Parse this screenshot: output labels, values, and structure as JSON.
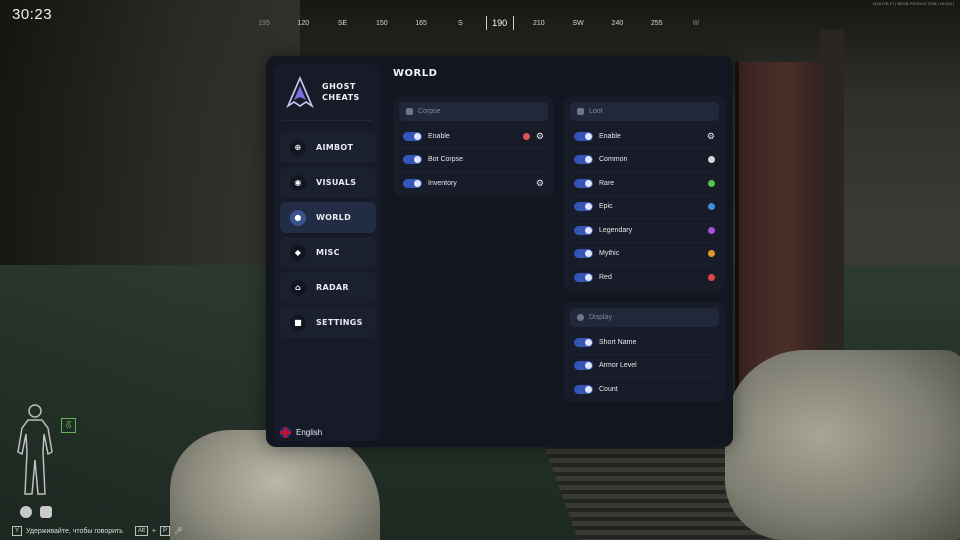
{
  "hud": {
    "timer": "30:23",
    "compass": [
      "195",
      "120",
      "SE",
      "150",
      "165",
      "S",
      "190",
      "210",
      "SW",
      "240",
      "255",
      "W"
    ],
    "compass_center": "190",
    "server_info": "1104 IVB 17 | BEGB PRODUCTION | v0.016 |",
    "voice_hint": "Удерживайте, чтобы говорить",
    "voice_key": "Y",
    "alt_key": "Alt",
    "plus": "+",
    "p_key": "P"
  },
  "brand": {
    "line1": "GHOST",
    "line2": "CHEATS"
  },
  "nav": [
    {
      "label": "AIMBOT",
      "icon": "crosshair-icon",
      "glyph": "⊕"
    },
    {
      "label": "VISUALS",
      "icon": "eye-icon",
      "glyph": "◉"
    },
    {
      "label": "WORLD",
      "icon": "globe-icon",
      "glyph": "●"
    },
    {
      "label": "MISC",
      "icon": "shield-icon",
      "glyph": "◆"
    },
    {
      "label": "RADAR",
      "icon": "radar-icon",
      "glyph": "⌂"
    },
    {
      "label": "SETTINGS",
      "icon": "cube-icon",
      "glyph": "■"
    }
  ],
  "language": "English",
  "page_title": "WORLD",
  "corpse": {
    "title": "Corpse",
    "rows": [
      {
        "label": "Enable",
        "color": "#e05555",
        "gear": true,
        "on": true
      },
      {
        "label": "Bot Corpse",
        "color": "",
        "gear": false,
        "on": true
      },
      {
        "label": "Inventory",
        "color": "",
        "gear": true,
        "on": true
      }
    ]
  },
  "loot": {
    "title": "Loot",
    "rows": [
      {
        "label": "Enable",
        "color": "",
        "gear": true,
        "on": true
      },
      {
        "label": "Common",
        "color": "#d6d6d6",
        "gear": false,
        "on": true
      },
      {
        "label": "Rare",
        "color": "#4fc64a",
        "gear": false,
        "on": true
      },
      {
        "label": "Epic",
        "color": "#3d8fe0",
        "gear": false,
        "on": true
      },
      {
        "label": "Legendary",
        "color": "#a64fe0",
        "gear": false,
        "on": true
      },
      {
        "label": "Mythic",
        "color": "#e09a30",
        "gear": false,
        "on": true
      },
      {
        "label": "Red",
        "color": "#e04848",
        "gear": false,
        "on": true
      }
    ]
  },
  "display": {
    "title": "Display",
    "rows": [
      {
        "label": "Short Name",
        "on": true
      },
      {
        "label": "Armor Level",
        "on": true
      },
      {
        "label": "Count",
        "on": true
      }
    ]
  }
}
